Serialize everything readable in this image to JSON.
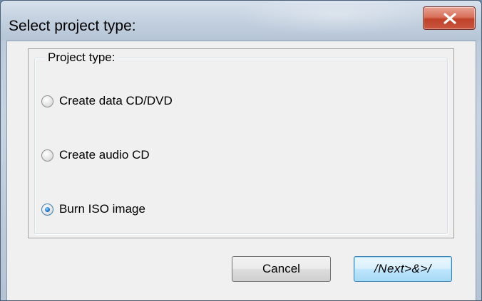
{
  "window": {
    "title": "Select project type:"
  },
  "group": {
    "legend": "Project type:",
    "options": [
      {
        "label": "Create data CD/DVD",
        "checked": false
      },
      {
        "label": "Create audio CD",
        "checked": false
      },
      {
        "label": "Burn ISO image",
        "checked": true
      }
    ]
  },
  "buttons": {
    "cancel_label": "Cancel",
    "next_label": "/Next>&>/"
  },
  "icons": {
    "close": "close-icon"
  }
}
